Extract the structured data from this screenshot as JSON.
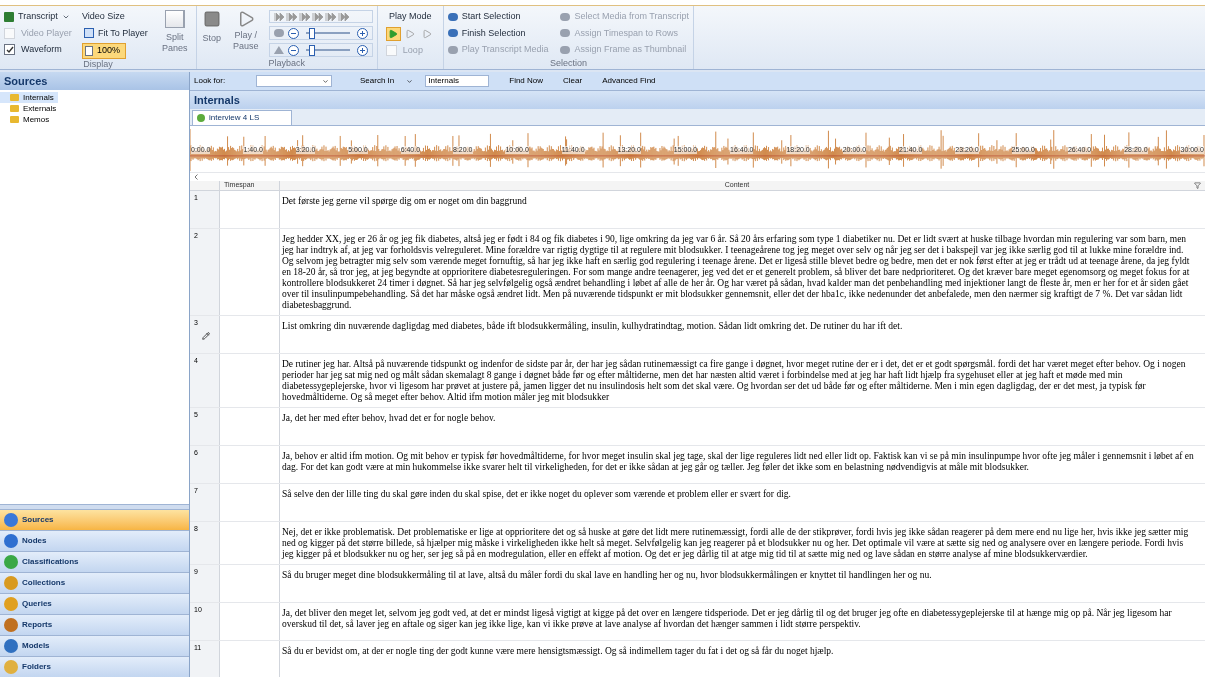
{
  "ribbon": {
    "display": {
      "label": "Display",
      "transcript": "Transcript",
      "video_player": {
        "label": "Video Player",
        "checked": false,
        "disabled": true
      },
      "waveform": {
        "label": "Waveform",
        "checked": true,
        "disabled": false
      },
      "video_size": "Video Size",
      "fit_to_player": {
        "label": "Fit To Player",
        "selected": false
      },
      "zoom": {
        "label": "100%",
        "selected": true
      },
      "split_panes": "Split Panes"
    },
    "playback": {
      "label": "Playback",
      "stop": "Stop",
      "play_pause": "Play / Pause",
      "volume": {
        "level": 0.12
      },
      "speed": {
        "level": 0.12
      }
    },
    "play_mode": {
      "label": "Play Mode",
      "modes": [
        {
          "selected": true
        },
        {
          "selected": false
        },
        {
          "selected": false
        }
      ],
      "loop": {
        "label": "Loop",
        "checked": false,
        "disabled": true
      }
    },
    "selection": {
      "label": "Selection",
      "items": [
        {
          "label": "Start Selection",
          "disabled": false
        },
        {
          "label": "Finish Selection",
          "disabled": false
        },
        {
          "label": "Play Transcript Media",
          "disabled": true
        },
        {
          "label": "Select Media from Transcript",
          "disabled": true
        },
        {
          "label": "Assign Timespan to Rows",
          "disabled": true
        },
        {
          "label": "Assign Frame as Thumbnail",
          "disabled": true
        }
      ]
    }
  },
  "sidebar": {
    "title": "Sources",
    "tree": [
      {
        "label": "Internals",
        "selected": true
      },
      {
        "label": "Externals",
        "selected": false
      },
      {
        "label": "Memos",
        "selected": false
      }
    ],
    "nav": [
      {
        "label": "Sources",
        "selected": true,
        "color": "#3a78d8"
      },
      {
        "label": "Nodes",
        "selected": false,
        "color": "#2f6fd0"
      },
      {
        "label": "Classifications",
        "selected": false,
        "color": "#3aa845"
      },
      {
        "label": "Collections",
        "selected": false,
        "color": "#d89a20"
      },
      {
        "label": "Queries",
        "selected": false,
        "color": "#e0a020"
      },
      {
        "label": "Reports",
        "selected": false,
        "color": "#c07020"
      },
      {
        "label": "Models",
        "selected": false,
        "color": "#3070c0"
      },
      {
        "label": "Folders",
        "selected": false,
        "color": "#e0b040"
      }
    ]
  },
  "find_bar": {
    "look_for": "Look for:",
    "search_in": "Search In",
    "scope": "Internals",
    "find_now": "Find Now",
    "clear": "Clear",
    "advanced_find": "Advanced Find"
  },
  "panel": {
    "title": "Internals",
    "tabs": [
      {
        "label": "interview 4 LS",
        "selected": true
      }
    ]
  },
  "timeline": [
    "0:00.0",
    "1:40.0",
    "3:20.0",
    "5:00.0",
    "6:40.0",
    "8:20.0",
    "10:00.0",
    "11:40.0",
    "13:20.0",
    "15:00.0",
    "16:40.0",
    "18:20.0",
    "20:00.0",
    "21:40.0",
    "23:20.0",
    "25:00.0",
    "26:40.0",
    "28:20.0",
    "30:00.0"
  ],
  "table": {
    "columns": [
      "Timespan",
      "Content"
    ],
    "rows": [
      {
        "number": "1",
        "annotated": false,
        "content": "Det første jeg gerne vil spørge dig om er noget om din baggrund"
      },
      {
        "number": "2",
        "annotated": false,
        "content": "Jeg hedder XX, jeg er 26 år og jeg fik diabetes, altså jeg er født i 84 og fik diabetes i 90, lige omkring da jeg var 6 år. Så 20 års erfaring som type 1 diabetiker nu. Det er lidt svært at huske tilbage hvordan min regulering var som barn, men jeg har indtryk af, at jeg var forholdsvis velreguleret. Mine forældre var rigtig dygtige til at regulere mit blodsukker. I teenageårene tog jeg meget over selv og når jeg ser det i bakspejl var jeg ikke særlig god til at lukke mine forældre ind. Og selvom jeg betragter mig selv som værende meget fornuftig, så har jeg ikke haft en særlig god regulering i teenage årene. Det er ligeså stille blevet bedre og bedre, men det er nok først efter at jeg er trådt ud at teenage årene, da jeg fyldt en 18-20 år, så tror jeg, at jeg begyndte at opprioritere diabetesreguleringen. For som mange andre teenagerer, jeg ved det er et generelt problem, så bliver det bare nedprioriteret. Og det kræver bare meget egenomsorg og meget fokus for at kontrollere blodsukkeret 24 timer i døgnet. Så har jeg selvfølgelig også ændret behandling i løbet af alle de her år. Og har været på sådan, hvad kalder man det penbehandling med injektioner langt de fleste år, men er her for et år siden gået over til insulinpumpebehandling. Så det har måske også ændret lidt. Men på nuværende tidspunkt er mit blodsukker gennemsnit, eller det der hba1c, ikke nedenunder det anbefalede, men den nærmer sig kraftigt de 7 %. Det var sådan lidt diabetesbaggrund."
      },
      {
        "number": "3",
        "annotated": true,
        "content": "List omkring din nuværende dagligdag med diabetes, både ift blodsukkermåling, insulin, kulhydratindtag, motion. Sådan lidt omkring det. De rutiner du har ift det."
      },
      {
        "number": "4",
        "annotated": false,
        "content": "De rutiner jeg har. Altså på nuværende tidspunkt og indenfor de sidste par år, der har jeg sådan rutinemæssigt ca fire gange i døgnet, hvor meget rutine der er i det, det er et godt spørgsmål. fordi det har været meget efter behov. Og i nogen perioder har jeg sat mig ned og målt sådan skemalagt 8 gange i døgnet både før og efter måltiderne, men det har næsten altid været i forbindelse med at jeg har haft lidt hjælp fra sygehuset eller at jeg haft et møde med min diabetessygeplejerske, hvor vi ligesom har prøvet at justere på, jamen ligger det nu insulindosis helt som det skal være. Og hvordan ser det ud både før og efter måltiderne. Men i min egen dagligdag, der er det mest, ja typisk før hovedmåltiderne. Og så meget efter behov. Altid ifm motion måler jeg mit blodsukker"
      },
      {
        "number": "5",
        "annotated": false,
        "content": "Ja, det her med efter behov, hvad det er for nogle behov."
      },
      {
        "number": "6",
        "annotated": false,
        "content": "Ja, behov er altid ifm motion. Og mit behov er typisk før hovedmåltiderne, for hvor meget insulin skal jeg tage, skal der lige reguleres lidt ned eller lidt op. Faktisk kan vi se på min insulinpumpe hvor ofte jeg måler i gennemsnit i løbet af en dag. For det kan godt være at min hukommelse ikke svarer helt til virkeligheden, for det er ikke sådan at jeg går og tæller. Jeg føler det ikke som en belastning nødvendigvis at måle mit blodsukker."
      },
      {
        "number": "7",
        "annotated": false,
        "content": "Så selve den der lille ting du skal gøre inden du skal spise, det er ikke noget du oplever som værende et problem eller er svært for dig."
      },
      {
        "number": "8",
        "annotated": false,
        "content": "Nej, det er ikke problematisk. Det problematiske er lige at opprioritere det og så huske at gøre det lidt mere rutinemæssigt, fordi alle de der stikprøver, fordi hvis jeg ikke sådan reagerer på dem mere end nu lige her, hvis ikke jeg sætter mig ned og kigger på det større billede, så hjælper mig måske i virkeligheden ikke helt så meget. Selvfølgelig kan jeg reagerer på et blodsukker nu og her. Det optimale vil være at sætte sig ned og analysere over en længere periode. Fordi hvis jeg kigger på et blodsukker nu og her, ser jeg så på en modregulation, eller en effekt af motion. Og det er jeg dårlig til at atge mig tid til at sætte mig ned og lave sådan en større analyse af mine blodsukkerværdier."
      },
      {
        "number": "9",
        "annotated": false,
        "content": "Så du bruger meget dine blodsukkermåling til at lave, altså du måler fordi du skal lave en handling her og nu, hvor blodsukkermålingen er knyttet til handlingen her og nu."
      },
      {
        "number": "10",
        "annotated": false,
        "content": "Ja, det bliver den meget let, selvom jeg godt ved, at det er mindst ligeså vigtigt at kigge på det over en længere tidsperiode. Det er jeg dårlig til og det bruger jeg ofte en diabetessygeplejerske til at hænge mig op på. Når jeg ligesom har overskud til det, så laver jeg en aftale og siger kan jeg ikke lige, kan vi ikke prøve at lave analyse af hvordan det hænger sammen i lidt større perspektiv."
      },
      {
        "number": "11",
        "annotated": false,
        "content": "Så du er bevidst om, at der er nogle ting der godt kunne være mere hensigtsmæssigt. Og så indimellem tager du fat i det og så får du noget hjælp."
      }
    ]
  }
}
